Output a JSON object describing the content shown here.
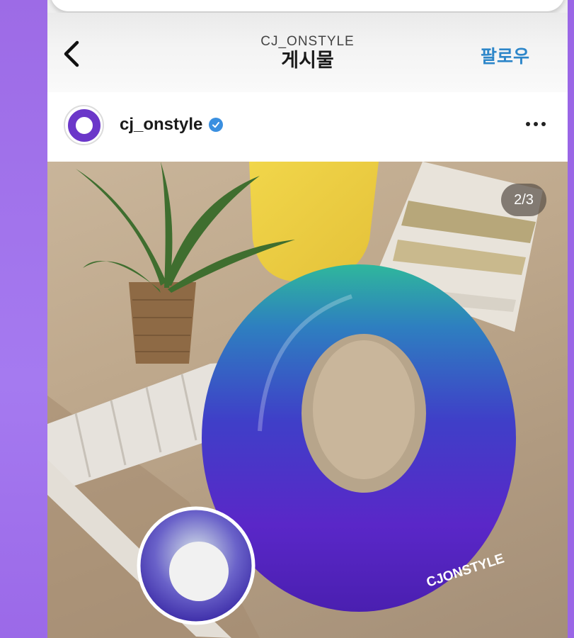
{
  "nav": {
    "account": "CJ_ONSTYLE",
    "title": "게시물",
    "follow_label": "팔로우"
  },
  "post": {
    "username": "cj_onstyle",
    "verified": true,
    "page_indicator": "2/3",
    "photo_brand_text": "CJONSTYLE"
  },
  "icons": {
    "back": "chevron-left-icon",
    "verified": "verified-badge-icon",
    "more": "more-horizontal-icon"
  },
  "colors": {
    "background_purple": "#a57af0",
    "follow_blue": "#2d86c9",
    "brand_purple": "#6b37c9",
    "verified_blue": "#3a8fe0"
  }
}
